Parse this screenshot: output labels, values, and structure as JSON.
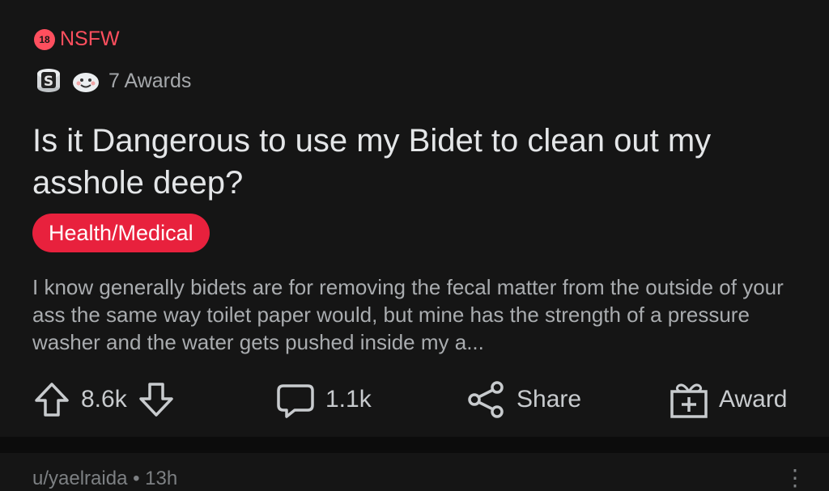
{
  "post": {
    "nsfw_badge": "18",
    "nsfw_label": "NSFW",
    "awards_label": "7 Awards",
    "title": "Is it Dangerous to use my Bidet to clean out my asshole deep?",
    "flair": "Health/Medical",
    "body": "I know generally bidets are for removing the fecal matter from the outside of your ass the same way toilet paper would, but mine has the strength of a pressure washer and the water gets pushed inside my a...",
    "colors": {
      "nsfw": "#ff4f5e",
      "flair": "#e8213d",
      "background": "#151515"
    }
  },
  "actions": {
    "upvote_icon": "arrow-up-icon",
    "vote_count": "8.6k",
    "downvote_icon": "arrow-down-icon",
    "comment_icon": "comment-bubble-icon",
    "comment_count": "1.1k",
    "share_icon": "share-icon",
    "share_label": "Share",
    "award_icon": "gift-box-icon",
    "award_label": "Award"
  },
  "next_post": {
    "meta": "u/yaelraida • 13h",
    "more_icon": "more-vertical-icon"
  }
}
